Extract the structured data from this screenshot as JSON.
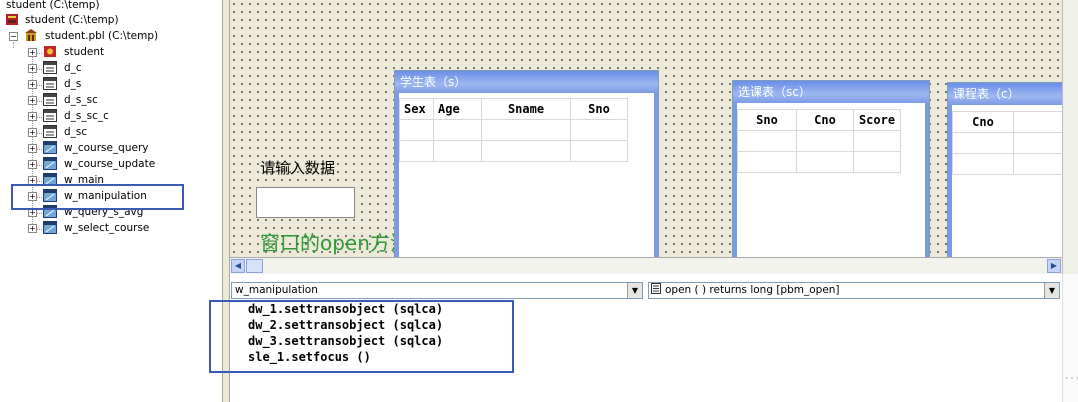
{
  "tree": {
    "items": [
      {
        "label": "student (C:\\temp)",
        "icon": "library-icon"
      },
      {
        "label": "student (C:\\temp)",
        "icon": "application-icon"
      },
      {
        "label": "student.pbl (C:\\temp)",
        "icon": "library-icon"
      },
      {
        "label": "student",
        "icon": "application-object-icon"
      },
      {
        "label": "d_c",
        "icon": "datawindow-icon"
      },
      {
        "label": "d_s",
        "icon": "datawindow-icon"
      },
      {
        "label": "d_s_sc",
        "icon": "datawindow-icon"
      },
      {
        "label": "d_s_sc_c",
        "icon": "datawindow-icon"
      },
      {
        "label": "d_sc",
        "icon": "datawindow-icon"
      },
      {
        "label": "w_course_query",
        "icon": "window-icon"
      },
      {
        "label": "w_course_update",
        "icon": "window-icon"
      },
      {
        "label": "w_main",
        "icon": "window-icon"
      },
      {
        "label": "w_manipulation",
        "icon": "window-icon"
      },
      {
        "label": "w_query_s_avg",
        "icon": "window-icon"
      },
      {
        "label": "w_select_course",
        "icon": "window-icon"
      }
    ]
  },
  "canvas": {
    "prompt_label": "请输入数据",
    "annotation": "窗口的open方法",
    "annotation_color": "#2e9a3a",
    "dw_student": {
      "title": "学生表（s）",
      "columns": [
        "Sex",
        "Age",
        "Sname",
        "Sno"
      ]
    },
    "dw_sc": {
      "title": "选课表（sc）",
      "columns": [
        "Sno",
        "Cno",
        "Score"
      ]
    },
    "dw_course": {
      "title": "课程表（c）",
      "columns": [
        "Cno",
        ""
      ]
    }
  },
  "editor": {
    "object_select": "w_manipulation",
    "event_select": "open ( )  returns long [pbm_open]",
    "code_lines": [
      "dw_1.settransobject (sqlca)",
      "dw_2.settransobject (sqlca)",
      "dw_3.settransobject (sqlca)",
      "sle_1.setfocus ()"
    ]
  },
  "colors": {
    "highlight_box": "#3a5ab8",
    "title_bar": "#6b8ee8"
  }
}
